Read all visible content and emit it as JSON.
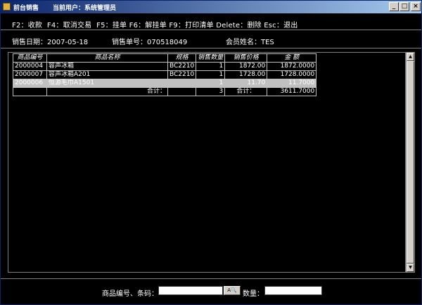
{
  "window": {
    "title": "前台销售",
    "current_user": "当前用户：系统管理员",
    "minimize": "_",
    "maximize": "□",
    "close": "×"
  },
  "hotkeys": "F2：收款  F4：取消交易  F5：挂单 F6：解挂单 F9：打印清单 Delete：删除 Esc：退出",
  "info": {
    "date_label": "销售日期：",
    "date_value": "2007-05-18",
    "order_label": "销售单号：",
    "order_value": "070518049",
    "member_label": "会员姓名：",
    "member_value": "TES"
  },
  "table": {
    "headers": [
      "商品编号",
      "商品名称",
      "规格",
      "销售数量",
      "销售价格",
      "金 额"
    ],
    "rows": [
      {
        "code": "2000004",
        "name": "容声冰箱",
        "spec": "BC2210",
        "qty": "1",
        "price": "1872.00",
        "amount": "1872.0000"
      },
      {
        "code": "2000007",
        "name": "容声冰箱A201",
        "spec": "BC2210",
        "qty": "1",
        "price": "1728.00",
        "amount": "1728.0000"
      },
      {
        "code": "2000006",
        "name": "恒源毛巾A1501",
        "spec": "",
        "qty": "1",
        "price": "11.70",
        "amount": "11.7000"
      }
    ],
    "selected_row": 2,
    "summary": {
      "label1": "合计：",
      "qty": "3",
      "label2": "合计：",
      "amount": "3611.7000"
    }
  },
  "bottom": {
    "code_label": "商品编号、条码：",
    "code_value": "",
    "search_icon_label": "A🔍",
    "qty_label": "数量：",
    "qty_value": ""
  }
}
